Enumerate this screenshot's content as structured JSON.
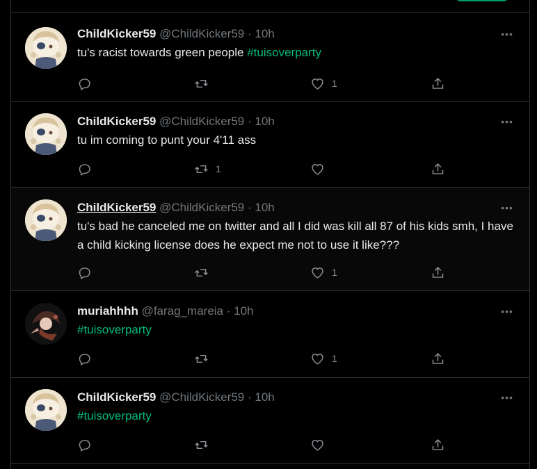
{
  "tweets": [
    {
      "name": "ChildKicker59",
      "handle": "@ChildKicker59",
      "time": "· 10h",
      "parts": [
        {
          "text": "tu's racist towards green people ",
          "tag": false
        },
        {
          "text": "#tuisoverparty",
          "tag": true
        }
      ],
      "counts": {
        "reply": "",
        "retweet": "",
        "like": "1",
        "share": ""
      }
    },
    {
      "name": "ChildKicker59",
      "handle": "@ChildKicker59",
      "time": "· 10h",
      "parts": [
        {
          "text": "tu im coming to punt your 4'11 ass",
          "tag": false
        }
      ],
      "counts": {
        "reply": "",
        "retweet": "1",
        "like": "",
        "share": ""
      }
    },
    {
      "name": "ChildKicker59",
      "handle": "@ChildKicker59",
      "time": "· 10h",
      "parts": [
        {
          "text": "tu's bad he canceled me on twitter and all I did was kill all 87 of his kids smh, I have a child kicking license does he expect me not to use it like???",
          "tag": false
        }
      ],
      "counts": {
        "reply": "",
        "retweet": "",
        "like": "1",
        "share": ""
      }
    },
    {
      "name": "muriahhhh",
      "handle": "@farag_mareia",
      "time": "· 10h",
      "parts": [
        {
          "text": "#tuisoverparty",
          "tag": true
        }
      ],
      "counts": {
        "reply": "",
        "retweet": "",
        "like": "1",
        "share": ""
      }
    },
    {
      "name": "ChildKicker59",
      "handle": "@ChildKicker59",
      "time": "· 10h",
      "parts": [
        {
          "text": "#tuisoverparty",
          "tag": true
        }
      ],
      "counts": {
        "reply": "",
        "retweet": "",
        "like": "",
        "share": ""
      }
    }
  ],
  "icons": {
    "more": "more-icon",
    "reply": "reply-icon",
    "retweet": "retweet-icon",
    "like": "heart-icon",
    "share": "share-icon"
  },
  "colors": {
    "background": "#000000",
    "hashtag": "#00ba7c",
    "muted": "#71767b",
    "divider": "#2f3336",
    "text": "#e7e9ea"
  }
}
